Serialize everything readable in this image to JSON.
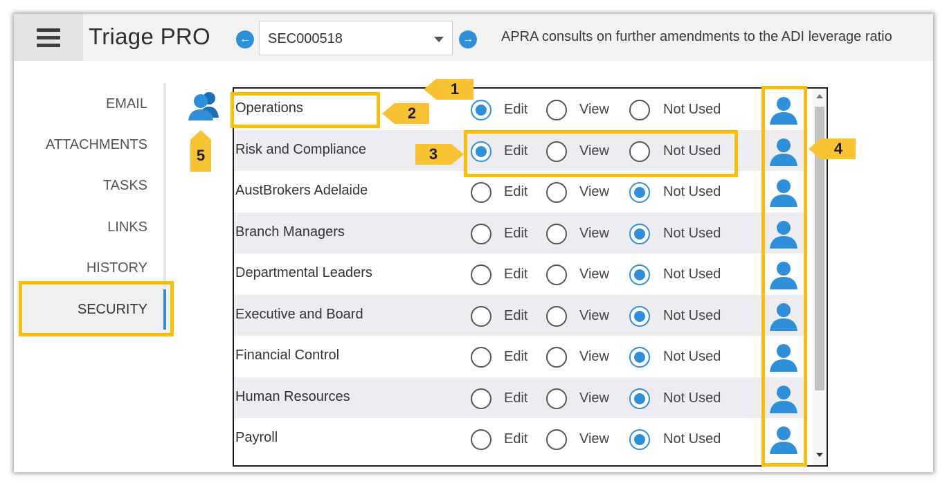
{
  "app": {
    "title": "Triage PRO"
  },
  "header": {
    "menu_icon": "hamburger-icon",
    "prev_icon": "arrow-left-circle-icon",
    "next_icon": "arrow-right-circle-icon",
    "record_id": "SEC000518",
    "headline": "APRA consults on further amendments to the ADI leverage ratio"
  },
  "sidebar": {
    "items": [
      {
        "label": "EMAIL"
      },
      {
        "label": "ATTACHMENTS"
      },
      {
        "label": "TASKS"
      },
      {
        "label": "LINKS"
      },
      {
        "label": "HISTORY"
      },
      {
        "label": "SECURITY",
        "active": true
      }
    ]
  },
  "security": {
    "group_icon": "user-group-icon",
    "options": {
      "edit": "Edit",
      "view": "View",
      "not_used": "Not Used"
    },
    "rows": [
      {
        "name": "Operations",
        "access": "edit"
      },
      {
        "name": "Risk and Compliance",
        "access": "edit"
      },
      {
        "name": "AustBrokers Adelaide",
        "access": "not_used"
      },
      {
        "name": "Branch Managers",
        "access": "not_used"
      },
      {
        "name": "Departmental Leaders",
        "access": "not_used"
      },
      {
        "name": "Executive and Board",
        "access": "not_used"
      },
      {
        "name": "Financial Control",
        "access": "not_used"
      },
      {
        "name": "Human Resources",
        "access": "not_used"
      },
      {
        "name": "Payroll",
        "access": "not_used"
      }
    ]
  },
  "callouts": [
    "1",
    "2",
    "3",
    "4",
    "5"
  ],
  "colors": {
    "accent": "#2f8fd8",
    "highlight": "#f7bf0b",
    "row_alt": "#ececf1"
  }
}
